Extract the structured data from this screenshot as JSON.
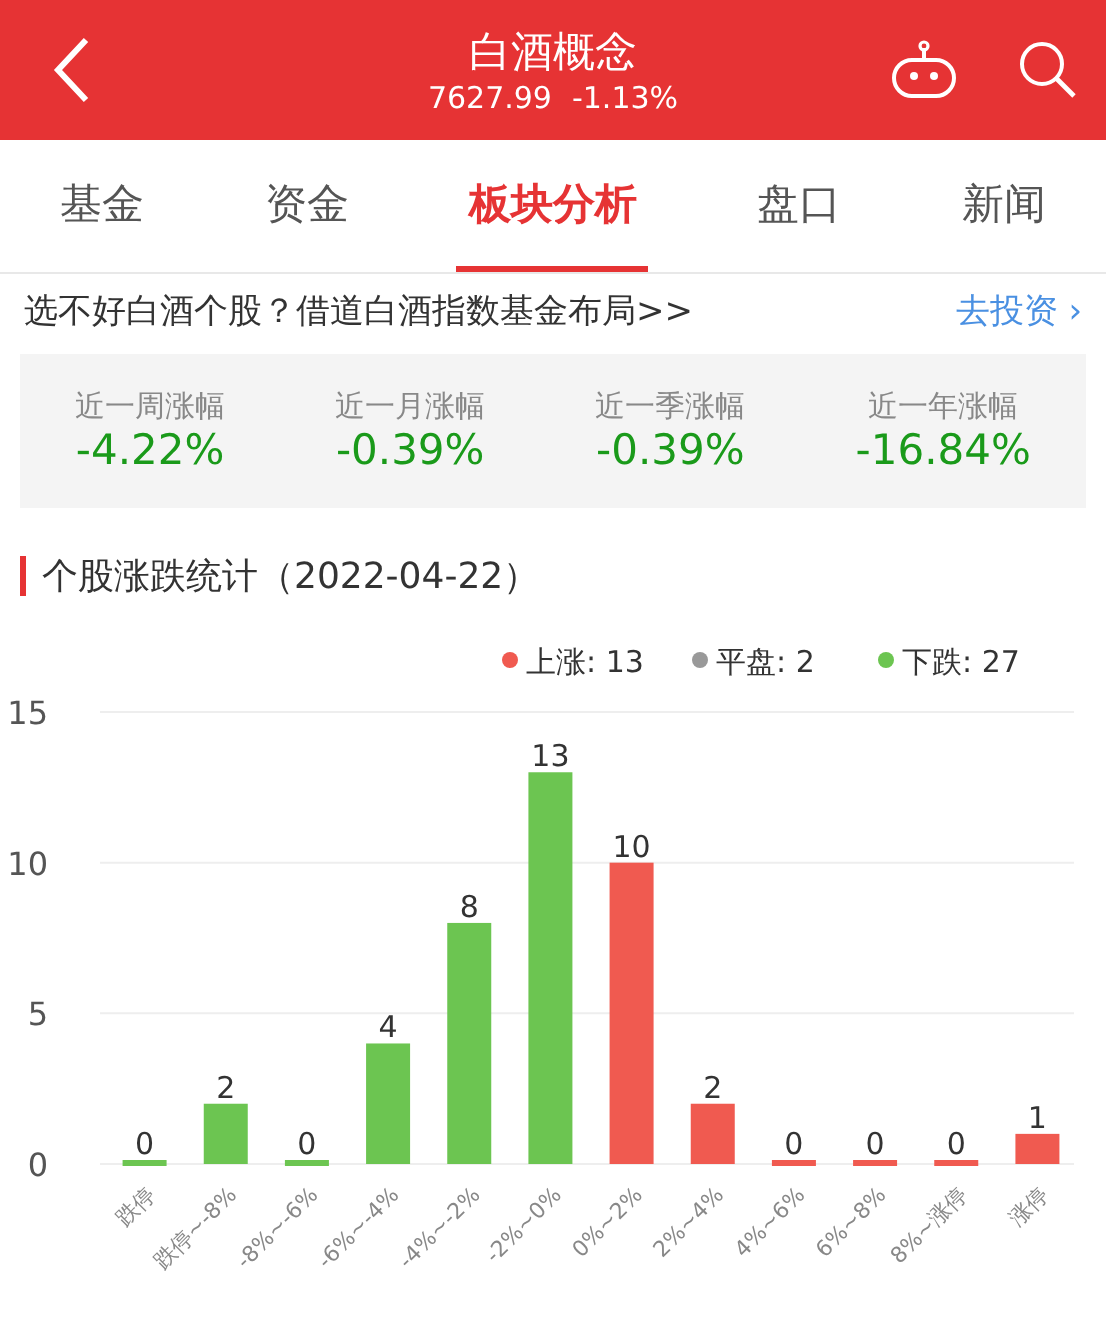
{
  "header": {
    "title": "白酒概念",
    "price": "7627.99",
    "change": "-1.13%"
  },
  "tabs": [
    {
      "label": "基金",
      "selected": false
    },
    {
      "label": "资金",
      "selected": false
    },
    {
      "label": "板块分析",
      "selected": true
    },
    {
      "label": "盘口",
      "selected": false
    },
    {
      "label": "新闻",
      "selected": false
    }
  ],
  "promo": {
    "text": "选不好白酒个股？借道白酒指数基金布局>>",
    "link": "去投资",
    "chevron": "›"
  },
  "stats": [
    {
      "label": "近一周涨幅",
      "value": "-4.22%"
    },
    {
      "label": "近一月涨幅",
      "value": "-0.39%"
    },
    {
      "label": "近一季涨幅",
      "value": "-0.39%"
    },
    {
      "label": "近一年涨幅",
      "value": "-16.84%"
    }
  ],
  "section_title": "个股涨跌统计（2022-04-22）",
  "legend": [
    {
      "text": "上涨: 13",
      "color": "#f05a50"
    },
    {
      "text": "平盘: 2",
      "color": "#999999"
    },
    {
      "text": "下跌: 27",
      "color": "#6cc551"
    }
  ],
  "chart": {
    "chart_data": {
      "type": "bar",
      "categories": [
        "跌停",
        "跌停~-8%",
        "-8%~-6%",
        "-6%~-4%",
        "-4%~-2%",
        "-2%~0%",
        "0%~2%",
        "2%~4%",
        "4%~6%",
        "6%~8%",
        "8%~涨停",
        "涨停"
      ],
      "ylim": [
        0,
        15
      ],
      "yticks": [
        0,
        5,
        10,
        15
      ],
      "data_labels": true,
      "series": [
        {
          "color": "#6cc551",
          "values": [
            0,
            2,
            0,
            4,
            8,
            13,
            null,
            null,
            null,
            null,
            null,
            null
          ]
        },
        {
          "color": "#f05a50",
          "values": [
            null,
            null,
            null,
            null,
            null,
            null,
            10,
            2,
            0,
            0,
            0,
            1
          ]
        }
      ]
    }
  }
}
